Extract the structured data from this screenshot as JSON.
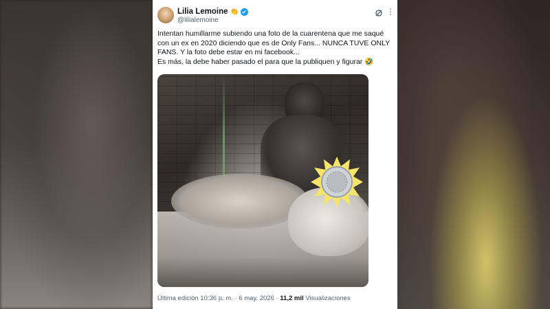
{
  "tweet": {
    "display_name": "Lilia Lemoine",
    "name_emoji": "👏",
    "handle": "@lilialemoine",
    "text_lines": [
      "Intentan humillarme subiendo una foto de la cuarentena que me saqué con un ex en 2020 diciendo que es de Only Fans... NUNCA TUVE ONLY FANS. Y la foto debe estar en mi facebook...",
      "Es más, la debe haber pasado el para que la publiquen y figurar 🤣"
    ],
    "footer": {
      "edit_label": "Última edición 10:36 p. m. · 6 may. 2026 · ",
      "views_count": "11,2 mil",
      "views_label": " Visualizaciones"
    }
  },
  "icons": {
    "verified": "verified-badge-icon",
    "grok": "grok-icon",
    "more": "more-options-icon"
  },
  "colors": {
    "verified_blue": "#1d9bf0",
    "text_primary": "#0f1419",
    "text_secondary": "#536471"
  }
}
